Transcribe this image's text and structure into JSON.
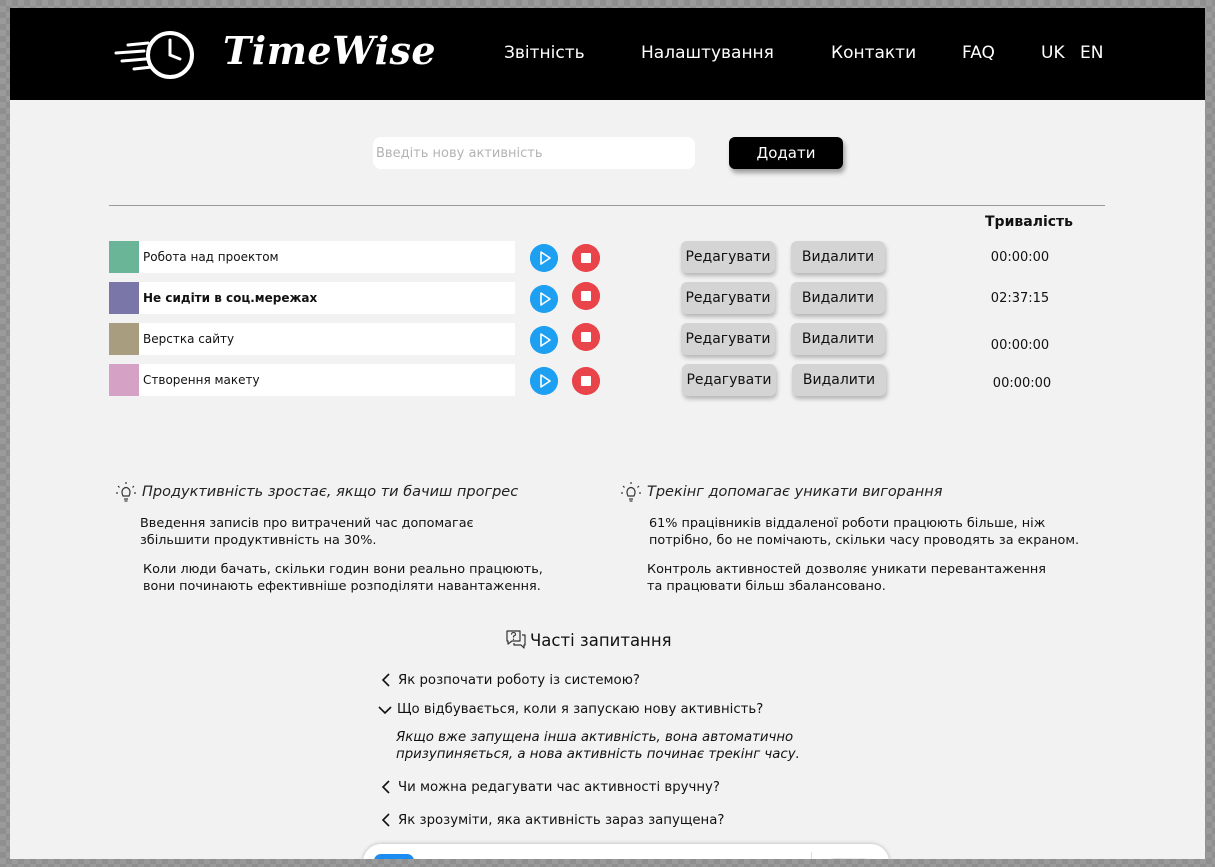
{
  "app": {
    "name": "TimeWise"
  },
  "nav": {
    "reports": "Звітність",
    "settings": "Налаштування",
    "contacts": "Контакти",
    "faq": "FAQ",
    "lang_uk": "UK",
    "lang_en": "EN"
  },
  "add_activity": {
    "placeholder": "Введіть нову активність",
    "value": "",
    "button_label": "Додати"
  },
  "table": {
    "duration_header": "Тривалість",
    "edit_label": "Редагувати",
    "delete_label": "Видалити",
    "rows": [
      {
        "name": "Робота над проектом",
        "color": "#6ab597",
        "duration": "00:00:00",
        "bold": false
      },
      {
        "name": "Не сидіти в соц.мережах",
        "color": "#7a76a8",
        "duration": "02:37:15",
        "bold": true
      },
      {
        "name": "Верстка сайту",
        "color": "#a89d7e",
        "duration": "00:00:00",
        "bold": false
      },
      {
        "name": "Створення макету",
        "color": "#d5a1c4",
        "duration": "00:00:00",
        "bold": false
      }
    ]
  },
  "tips": [
    {
      "icon": "lightbulb-icon",
      "title": "Продуктивність зростає, якщо ти бачиш прогрес",
      "paragraphs": [
        "Введення записів про витрачений час допомагає збільшити продуктивність на 30%.",
        "Коли люди бачать, скільки годин вони реально працюють, вони починають ефективніше розподіляти навантаження."
      ]
    },
    {
      "icon": "lightbulb-icon",
      "title": "Трекінг допомагає уникати вигорання",
      "paragraphs": [
        "61% працівників віддаленої роботи працюють більше, ніж потрібно, бо не помічають, скільки часу проводять за екраном.",
        "Контроль активностей дозволяє уникати перевантаження та працювати більш збалансовано."
      ]
    }
  ],
  "faq": {
    "title": "Часті запитання",
    "icon": "question-chat-icon",
    "items": [
      {
        "question": "Як розпочати роботу із системою?",
        "expanded": false
      },
      {
        "question": "Що відбувається, коли я запускаю нову активність?",
        "expanded": true,
        "answer": "Якщо вже запущена інша активність, вона автоматично призупиняється, а нова активність починає трекінг часу."
      },
      {
        "question": "Чи можна редагувати час активності вручну?",
        "expanded": false
      },
      {
        "question": "Як зрозуміти, яка активність зараз запущена?",
        "expanded": false
      }
    ]
  },
  "colors": {
    "header_bg": "#000000",
    "play": "#1d9ff2",
    "stop": "#e8444a",
    "toolbar_active": "#1b8cf2"
  }
}
